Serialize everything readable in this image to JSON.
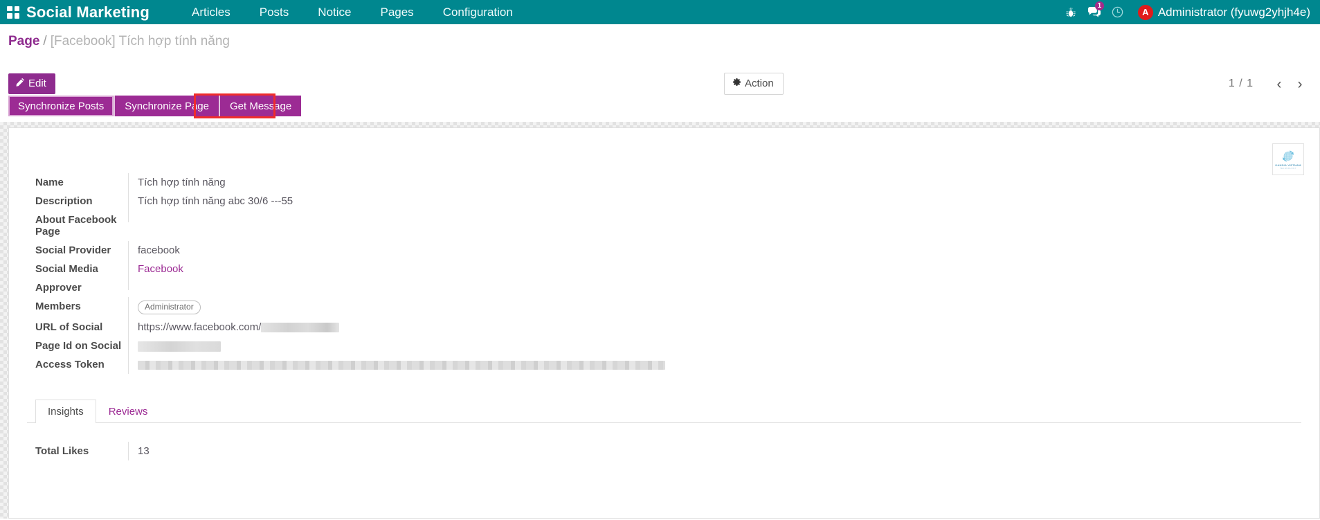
{
  "navbar": {
    "apps_icon": "apps-grid-icon",
    "brand": "Social Marketing",
    "menu": [
      {
        "label": "Articles"
      },
      {
        "label": "Posts"
      },
      {
        "label": "Notice"
      },
      {
        "label": "Pages"
      },
      {
        "label": "Configuration"
      }
    ],
    "icons": [
      {
        "name": "bug-icon"
      },
      {
        "name": "messages-icon",
        "badge": "1"
      },
      {
        "name": "activity-clock-icon"
      }
    ],
    "user": {
      "avatar_initial": "A",
      "avatar_color": "#e01b1b",
      "name": "Administrator (fyuwg2yhjh4e)"
    },
    "background_color": "#00878f"
  },
  "control": {
    "breadcrumb": {
      "root": "Page",
      "separator": "/",
      "current": "[Facebook] Tích hợp tính năng"
    },
    "edit_label": "Edit",
    "action_label": "Action",
    "pager": {
      "count": "1 / 1",
      "prev": "‹",
      "next": "›"
    },
    "accent_color": "#8e2b8e"
  },
  "stat_buttons": [
    {
      "label": "Synchronize Posts",
      "active": true
    },
    {
      "label": "Synchronize Page",
      "active": false
    },
    {
      "label": "Get Message",
      "active": false,
      "highlighted": true
    }
  ],
  "highlight_color": "#ef2c2c",
  "sheet": {
    "logo": {
      "title": "KANDIA VIETNAM",
      "subtitle": "TECHNOLOGY"
    },
    "fields": [
      {
        "label": "Name",
        "value": "Tích hợp tính năng",
        "type": "text"
      },
      {
        "label": "Description",
        "value": "Tích hợp tính năng abc 30/6 ---55",
        "type": "text"
      },
      {
        "label": "About Facebook Page",
        "value": "",
        "type": "text"
      },
      {
        "label": "Social Provider",
        "value": "facebook",
        "type": "text"
      },
      {
        "label": "Social Media",
        "value": "Facebook",
        "type": "link"
      },
      {
        "label": "Approver",
        "value": "",
        "type": "text"
      },
      {
        "label": "Members",
        "value": "Administrator",
        "type": "tag"
      },
      {
        "label": "URL of Social",
        "value": "https://www.facebook.com/",
        "type": "redacted-suffix"
      },
      {
        "label": "Page Id on Social",
        "value": "",
        "type": "redacted"
      },
      {
        "label": "Access Token",
        "value": "",
        "type": "redacted-long"
      }
    ],
    "notebook": {
      "tabs": [
        {
          "label": "Insights",
          "active": true
        },
        {
          "label": "Reviews",
          "active": false
        }
      ],
      "insights": {
        "total_likes_label": "Total Likes",
        "total_likes_value": "13"
      }
    }
  }
}
